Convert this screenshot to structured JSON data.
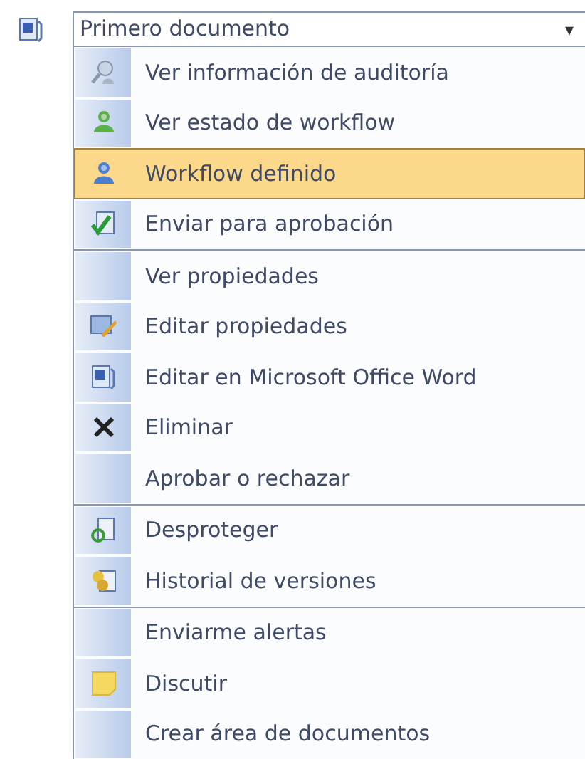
{
  "dropdown": {
    "value": "Primero documento",
    "arrow": "▾"
  },
  "menu": {
    "sections": [
      {
        "items": [
          {
            "label": "Ver información de auditoría",
            "selected": false
          },
          {
            "label": "Ver estado de workflow",
            "selected": false
          },
          {
            "label": "Workflow definido",
            "selected": true
          },
          {
            "label": "Enviar para aprobación",
            "selected": false
          }
        ]
      },
      {
        "items": [
          {
            "label": "Ver propiedades",
            "selected": false
          },
          {
            "label": "Editar propiedades",
            "selected": false
          },
          {
            "label": "Editar en Microsoft Office Word",
            "selected": false
          },
          {
            "label": "Eliminar",
            "selected": false
          },
          {
            "label": "Aprobar o rechazar",
            "selected": false
          }
        ]
      },
      {
        "items": [
          {
            "label": "Desproteger",
            "selected": false
          },
          {
            "label": "Historial de versiones",
            "selected": false
          }
        ]
      },
      {
        "items": [
          {
            "label": "Enviarme alertas",
            "selected": false
          },
          {
            "label": "Discutir",
            "selected": false
          },
          {
            "label": "Crear área de documentos",
            "selected": false
          }
        ]
      }
    ]
  }
}
